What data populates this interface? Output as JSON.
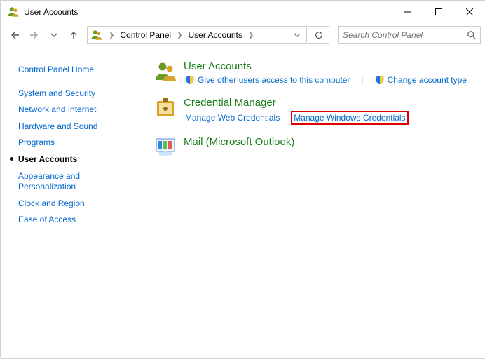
{
  "window": {
    "title": "User Accounts"
  },
  "breadcrumb": {
    "items": [
      "Control Panel",
      "User Accounts"
    ]
  },
  "search": {
    "placeholder": "Search Control Panel"
  },
  "sidebar": {
    "items": [
      {
        "label": "Control Panel Home",
        "current": false
      },
      {
        "label": "System and Security",
        "current": false
      },
      {
        "label": "Network and Internet",
        "current": false
      },
      {
        "label": "Hardware and Sound",
        "current": false
      },
      {
        "label": "Programs",
        "current": false
      },
      {
        "label": "User Accounts",
        "current": true
      },
      {
        "label": "Appearance and Personalization",
        "current": false
      },
      {
        "label": "Clock and Region",
        "current": false
      },
      {
        "label": "Ease of Access",
        "current": false
      }
    ]
  },
  "sections": {
    "user_accounts": {
      "title": "User Accounts",
      "links": {
        "give_access": "Give other users access to this computer",
        "change_type": "Change account type"
      }
    },
    "credential_manager": {
      "title": "Credential Manager",
      "links": {
        "web": "Manage Web Credentials",
        "windows": "Manage Windows Credentials"
      }
    },
    "mail": {
      "title": "Mail (Microsoft Outlook)"
    }
  }
}
